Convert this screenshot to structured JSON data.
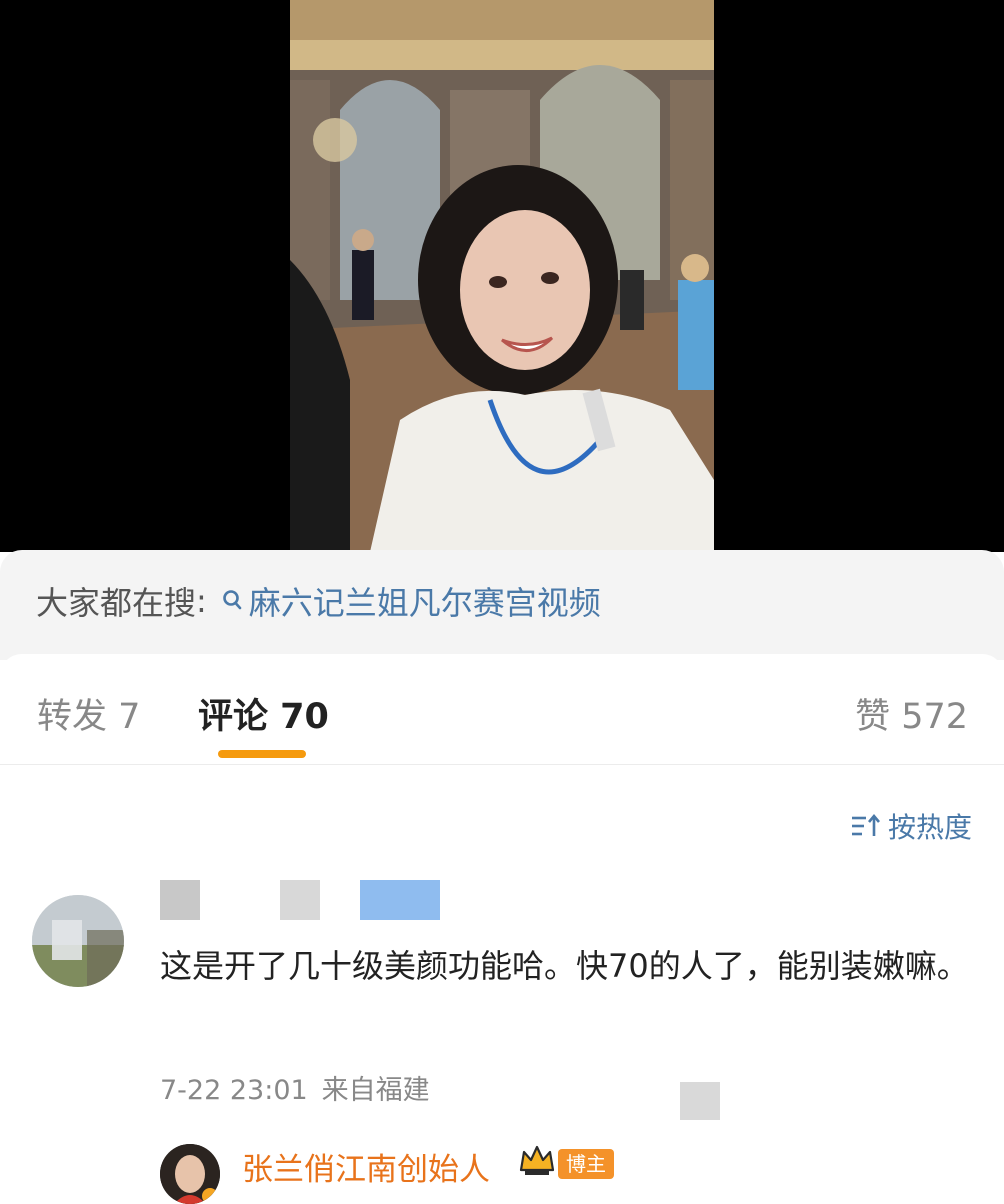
{
  "video": {
    "description_icon": "video-frame"
  },
  "search": {
    "label": "大家都在搜",
    "colon": ":",
    "keyword": "麻六记兰姐凡尔赛宫视频",
    "icon": "search-icon"
  },
  "tabs": {
    "repost": "转发 7",
    "comment": "评论 70",
    "like": "赞 572"
  },
  "sort": {
    "label": "按热度",
    "icon": "sort-icon"
  },
  "comment": {
    "text": "这是开了几十级美颜功能哈。快70的人了，能别装嫩嘛。",
    "date": "7-22 23:01",
    "source": "来自福建"
  },
  "reply": {
    "author": "张兰俏江南创始人",
    "badge": "博主",
    "badge_icon": "crown-icon"
  },
  "colors": {
    "accent": "#f59a0e",
    "link": "#4a79a8",
    "author": "#e8731b",
    "badge": "#f4922a"
  }
}
